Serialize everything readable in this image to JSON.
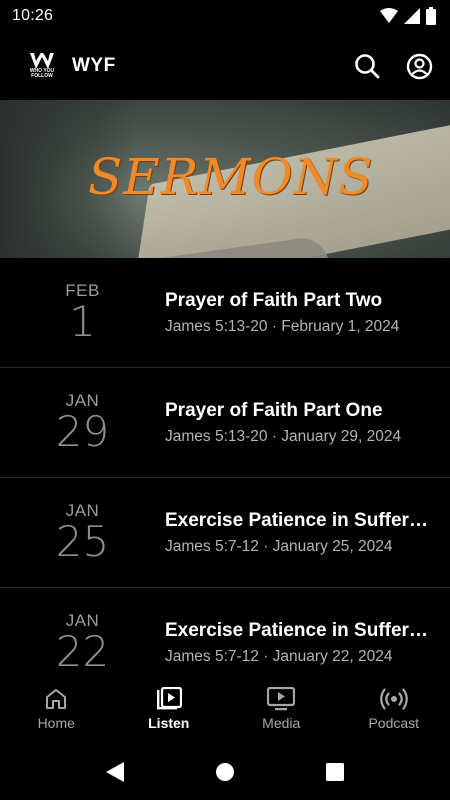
{
  "status_bar": {
    "time": "10:26"
  },
  "app_bar": {
    "logo_lines": [
      "WHO YOU",
      "FOLLOW"
    ],
    "title": "WYF"
  },
  "banner": {
    "title": "SERMONS"
  },
  "sermons": [
    {
      "month": "FEB",
      "day": "1",
      "title": "Prayer of Faith Part Two",
      "meta": "James 5:13-20 · February 1, 2024"
    },
    {
      "month": "JAN",
      "day": "29",
      "title": "Prayer of Faith Part One",
      "meta": "James 5:13-20 · January 29, 2024"
    },
    {
      "month": "JAN",
      "day": "25",
      "title": "Exercise Patience in Suffering",
      "meta": "James 5:7-12 · January 25, 2024"
    },
    {
      "month": "JAN",
      "day": "22",
      "title": "Exercise Patience in Suffering",
      "meta": "James 5:7-12 · January 22, 2024"
    }
  ],
  "bottom_nav": [
    {
      "label": "Home",
      "icon": "home-icon",
      "active": false
    },
    {
      "label": "Listen",
      "icon": "listen-icon",
      "active": true
    },
    {
      "label": "Media",
      "icon": "media-icon",
      "active": false
    },
    {
      "label": "Podcast",
      "icon": "podcast-icon",
      "active": false
    }
  ],
  "colors": {
    "accent": "#ef8a2a",
    "background": "#000000",
    "muted": "#9c9c9c"
  }
}
